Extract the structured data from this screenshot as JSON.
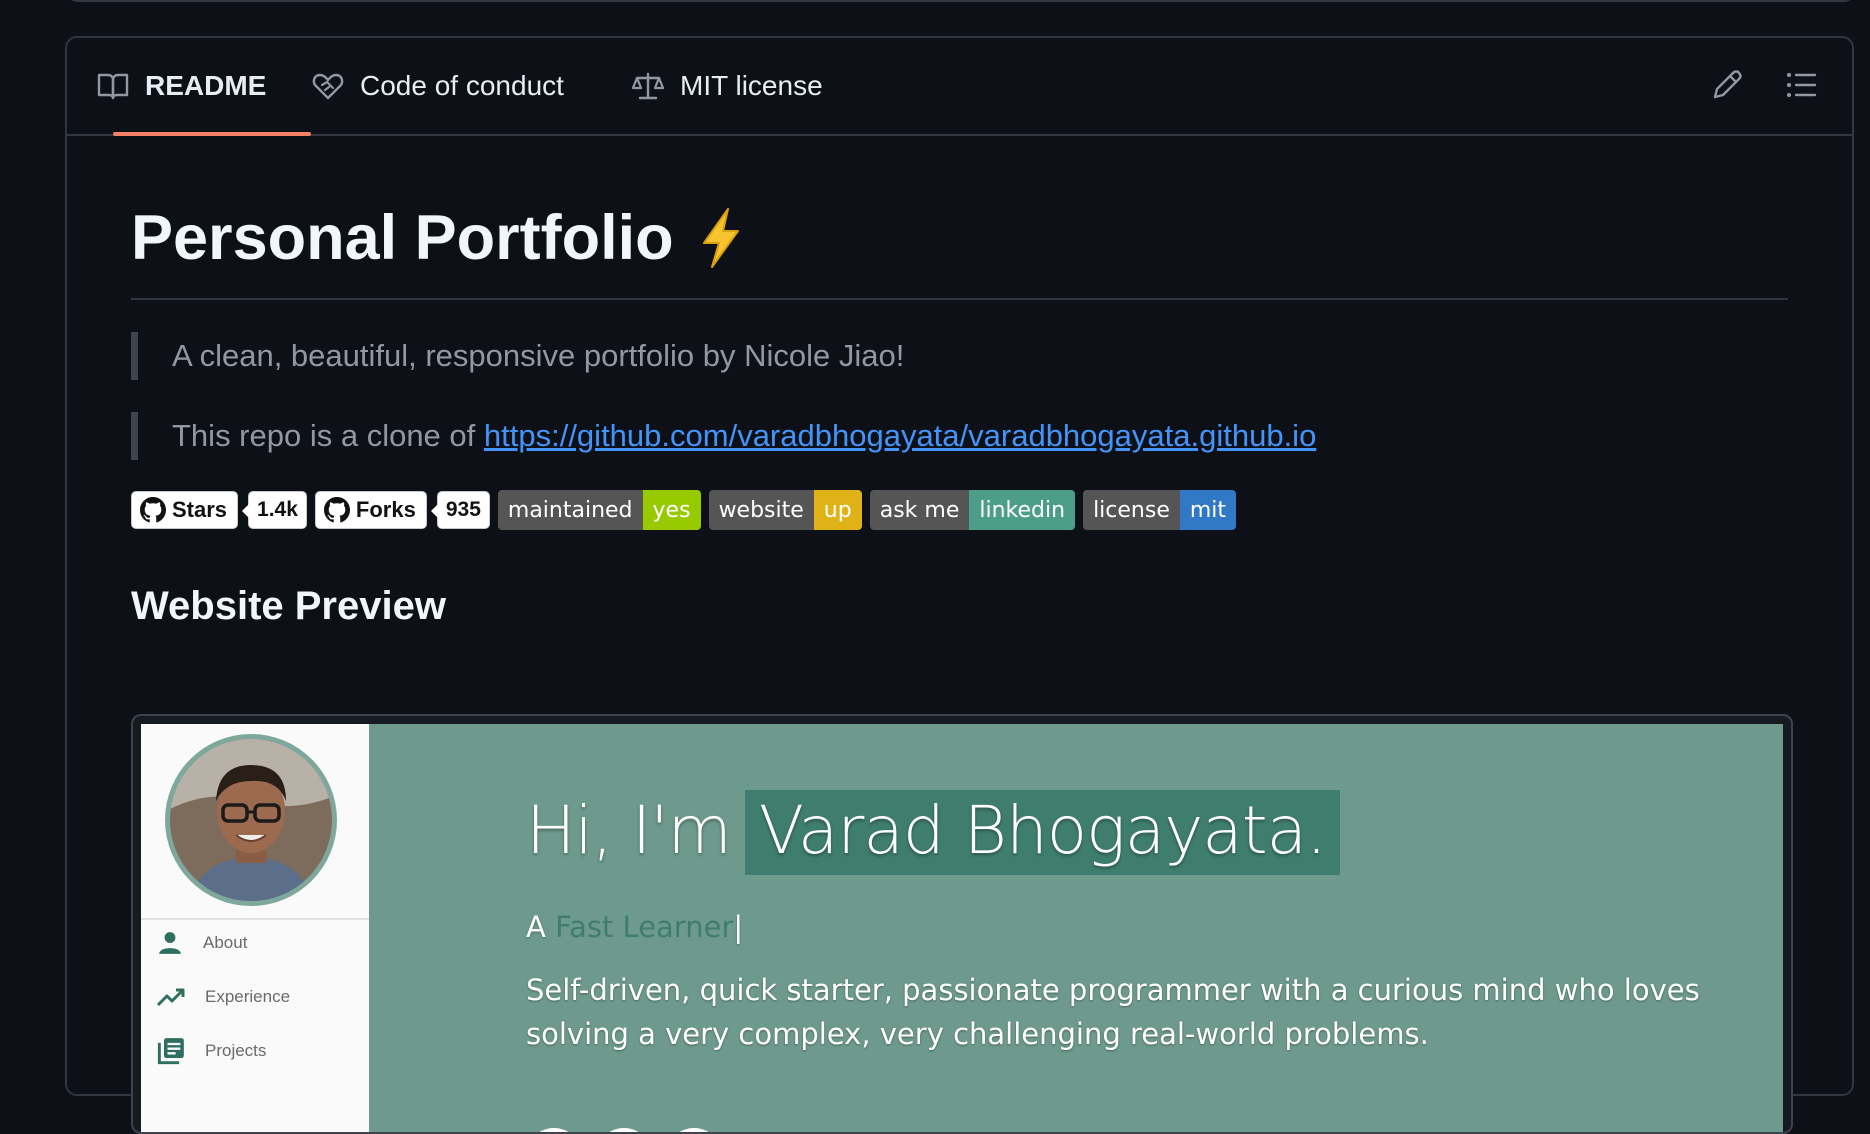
{
  "tabs": {
    "readme": "README",
    "code_of_conduct": "Code of conduct",
    "license": "MIT license"
  },
  "readme": {
    "title": "Personal Portfolio",
    "title_emoji": "⚡",
    "quote1": "A clean, beautiful, responsive portfolio by Nicole Jiao!",
    "quote2_prefix": "This repo is a clone of ",
    "quote2_link": "https://github.com/varadbhogayata/varadbhogayata.github.io",
    "section_heading": "Website Preview"
  },
  "badges": {
    "stars_label": "Stars",
    "stars_count": "1.4k",
    "forks_label": "Forks",
    "forks_count": "935",
    "shields": [
      {
        "left": "maintained",
        "right": "yes",
        "color": "#97ca00"
      },
      {
        "left": "website",
        "right": "up",
        "color": "#dfb317"
      },
      {
        "left": "ask me",
        "right": "linkedin",
        "color": "#4c9e89"
      },
      {
        "left": "license",
        "right": "mit",
        "color": "#3178c6"
      }
    ]
  },
  "preview": {
    "nav": [
      "About",
      "Experience",
      "Projects"
    ],
    "hero_greeting": "Hi, I'm",
    "hero_name": "Varad Bhogayata.",
    "subtitle_prefix": "A ",
    "subtitle_role": "Fast Learner",
    "caret": "|",
    "description": "Self-driven, quick starter, passionate programmer with a curious mind who loves solving a very complex, very challenging real-world problems."
  },
  "colors": {
    "page_bg": "#0d1117",
    "accent_underline": "#f78166",
    "link": "#4493f8",
    "preview_bg": "#6e9a8d",
    "name_highlight": "#3f7e6e"
  },
  "icons": [
    "book-icon",
    "heart-handshake-icon",
    "scale-icon",
    "pencil-icon",
    "list-icon",
    "github-mark-icon",
    "person-icon",
    "trending-up-icon",
    "projects-icon"
  ]
}
